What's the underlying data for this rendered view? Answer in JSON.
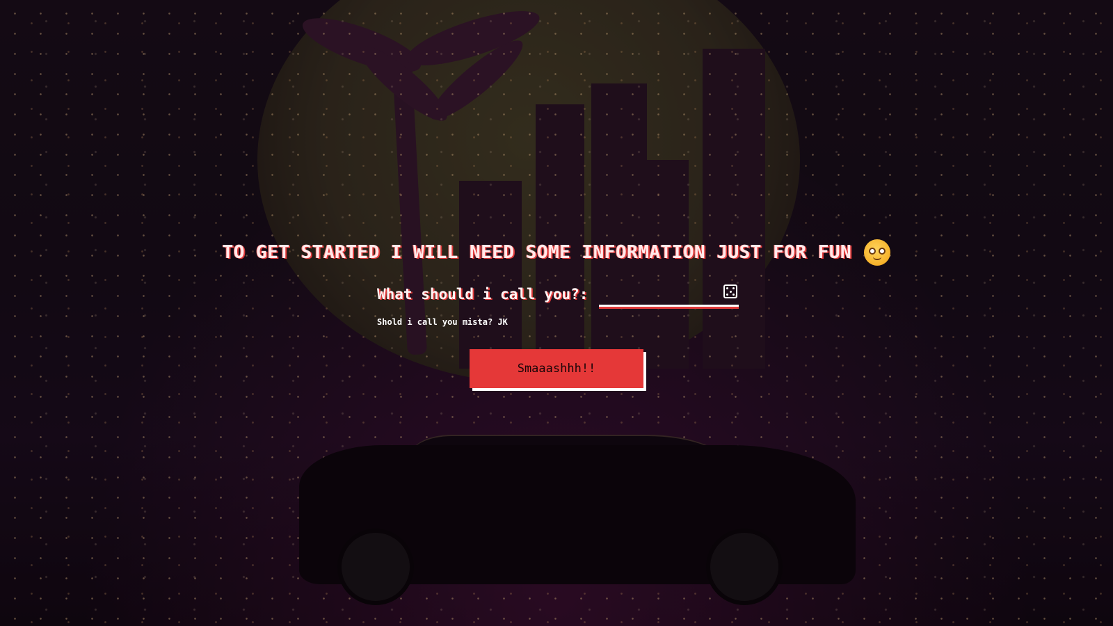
{
  "heading": {
    "text": "TO GET STARTED I WILL NEED SOME INFORMATION JUST FOR FUN",
    "emoji_icon": "smiling-face-emoji"
  },
  "name_field": {
    "label": "What should i call you?:",
    "value": "",
    "placeholder": "",
    "randomize_icon": "dice-icon",
    "hint": "Shold i call you mista? JK"
  },
  "submit": {
    "label": "Smaaashhh!!"
  },
  "colors": {
    "accent": "#e53838",
    "text": "#ffffff",
    "background": "#1b0f1b"
  }
}
